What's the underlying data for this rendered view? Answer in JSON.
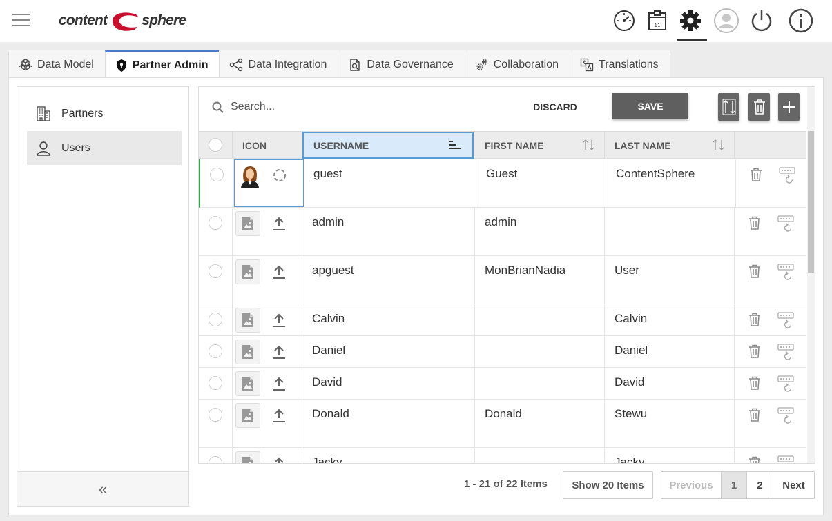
{
  "header": {
    "brand_part1": "content",
    "brand_part2": "sphere",
    "icons": [
      "dashboard-icon",
      "archive-box-icon",
      "gear-icon",
      "user-avatar-icon",
      "power-icon",
      "info-icon"
    ]
  },
  "tabs": [
    {
      "label": "Data Model",
      "icon": "cubes-icon"
    },
    {
      "label": "Partner Admin",
      "icon": "shield-icon",
      "active": true
    },
    {
      "label": "Data Integration",
      "icon": "share-nodes-icon"
    },
    {
      "label": "Data Governance",
      "icon": "document-check-icon"
    },
    {
      "label": "Collaboration",
      "icon": "gears-icon"
    },
    {
      "label": "Translations",
      "icon": "translate-icon"
    }
  ],
  "sidebar": {
    "items": [
      {
        "label": "Partners",
        "icon": "building-icon"
      },
      {
        "label": "Users",
        "icon": "user-icon",
        "active": true
      }
    ],
    "collapse_label": "«"
  },
  "toolbar": {
    "search_placeholder": "Search...",
    "discard_label": "DISCARD",
    "save_label": "SAVE"
  },
  "columns": {
    "icon": "ICON",
    "username": "USERNAME",
    "first_name": "FIRST NAME",
    "last_name": "LAST NAME"
  },
  "rows": [
    {
      "username": "guest",
      "first_name": "Guest",
      "last_name": "ContentSphere",
      "has_avatar": true
    },
    {
      "username": "admin",
      "first_name": "admin",
      "last_name": ""
    },
    {
      "username": "apguest",
      "first_name": "MonBrianNadia",
      "last_name": "User"
    },
    {
      "username": "Calvin",
      "first_name": "",
      "last_name": "Calvin"
    },
    {
      "username": "Daniel",
      "first_name": "",
      "last_name": "Daniel"
    },
    {
      "username": "David",
      "first_name": "",
      "last_name": "David"
    },
    {
      "username": "Donald",
      "first_name": "Donald",
      "last_name": "Stewu"
    },
    {
      "username": "Jacky",
      "first_name": "",
      "last_name": "Jacky"
    }
  ],
  "pager": {
    "info": "1 - 21 of 22 Items",
    "show_label": "Show 20 Items",
    "previous": "Previous",
    "pages": [
      "1",
      "2"
    ],
    "current_page": "1",
    "next": "Next"
  },
  "colors": {
    "accent_tab": "#4a79c8",
    "brand_red": "#c8102e",
    "save_button": "#5f5f5f",
    "selected_row_bar": "#2ea84a"
  }
}
